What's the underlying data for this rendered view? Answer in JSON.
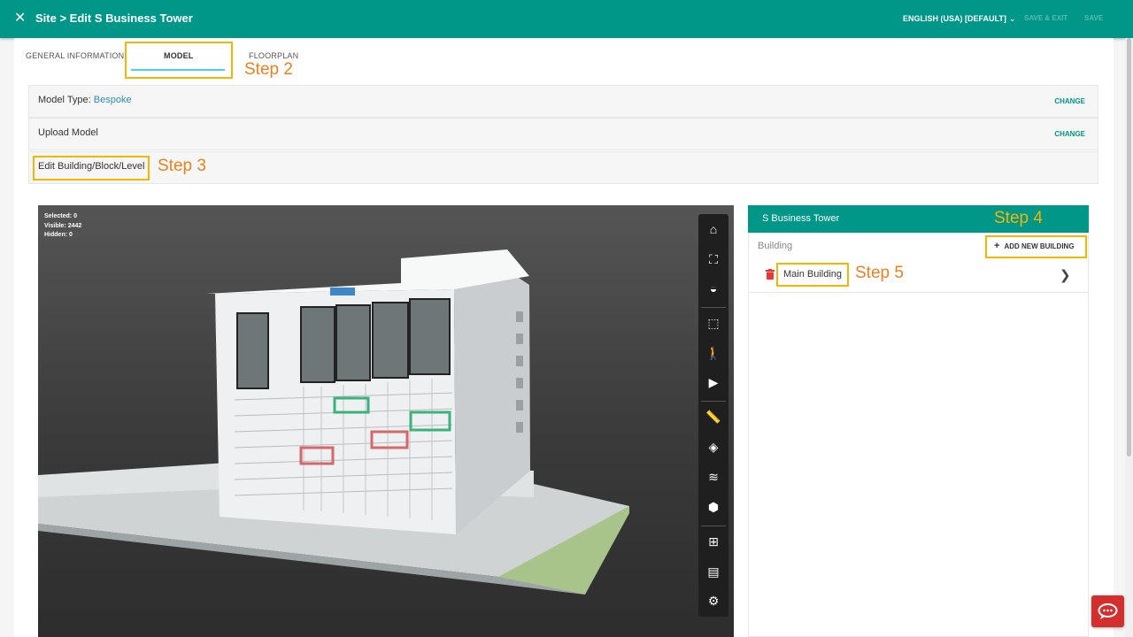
{
  "header": {
    "title": "Site > Edit S Business Tower",
    "language": "ENGLISH (USA) [DEFAULT]",
    "save_exit_label": "SAVE & EXIT",
    "save_label": "SAVE"
  },
  "tabs": [
    {
      "label": "GENERAL INFORMATION",
      "active": false
    },
    {
      "label": "MODEL",
      "active": true
    },
    {
      "label": "FLOORPLAN",
      "active": false
    }
  ],
  "annotations": {
    "step2": "Step 2",
    "step3": "Step 3",
    "step4": "Step 4",
    "step5": "Step 5"
  },
  "sections": {
    "model_type_label": "Model Type:",
    "model_type_value": "Bespoke",
    "upload_model_label": "Upload Model",
    "change_label": "CHANGE",
    "edit_building_label": "Edit Building/Block/Level"
  },
  "viewer": {
    "selected": "Selected: 0",
    "visible": "Visible: 2442",
    "hidden": "Hidden: 0",
    "tools": [
      "home-icon",
      "fit-view-icon",
      "render-mode-icon",
      "section-box-icon",
      "first-person-icon",
      "camera-icon",
      "measure-icon",
      "explode-icon",
      "layers-icon",
      "cube-icon",
      "model-tree-icon",
      "properties-icon",
      "settings-icon"
    ]
  },
  "panel": {
    "site_name": "S Business Tower",
    "building_label": "Building",
    "add_building_label": "ADD NEW BUILDING",
    "buildings": [
      "Main Building"
    ]
  },
  "colors": {
    "primary": "#009688",
    "step_orange": "#e8821e",
    "step_yellow": "#f2b705",
    "chat": "#d32f2f"
  }
}
